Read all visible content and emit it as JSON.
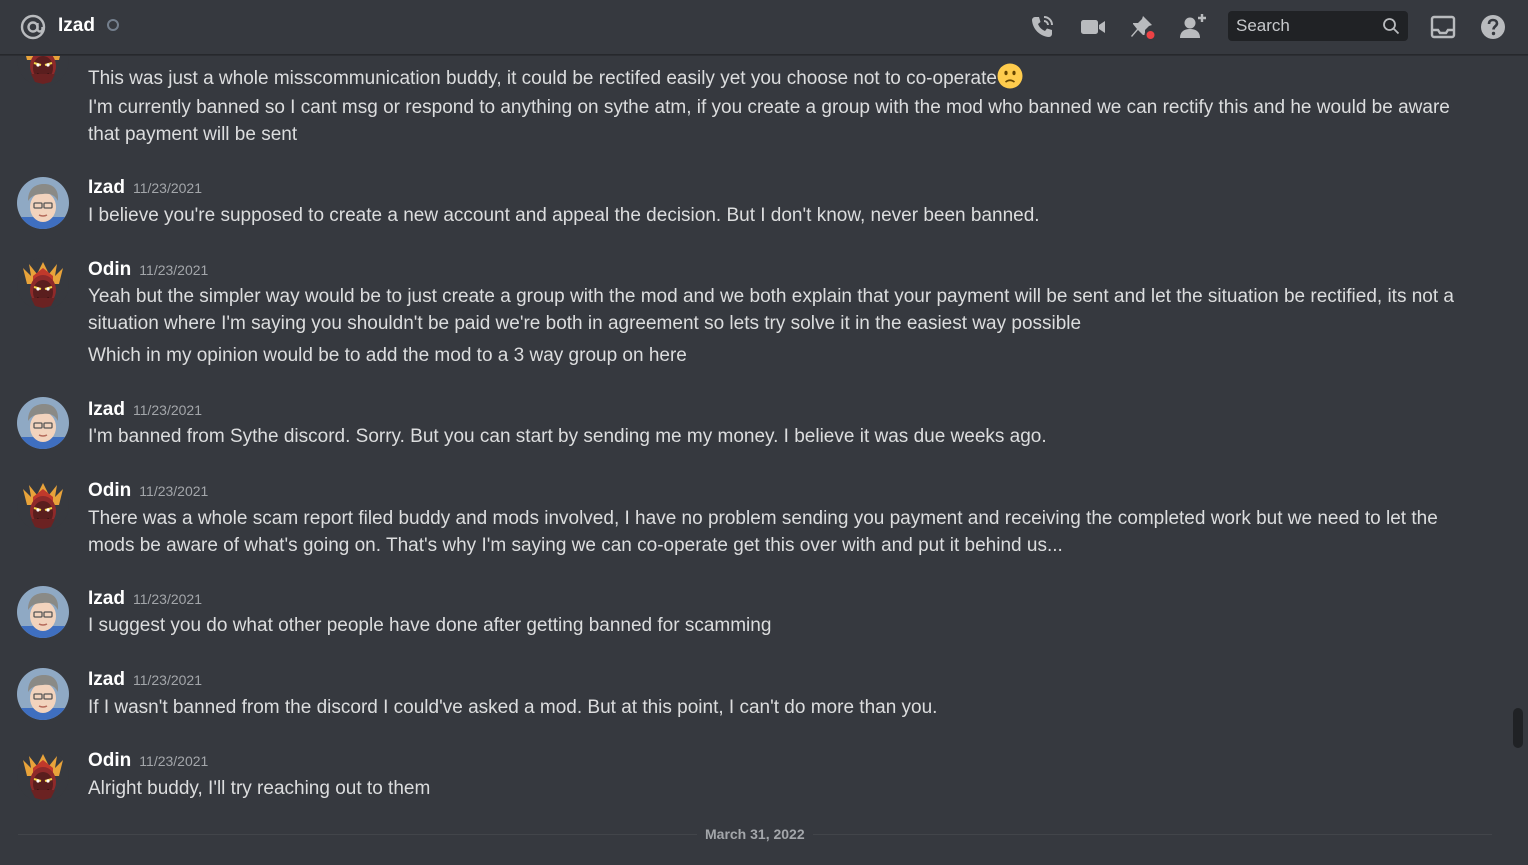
{
  "header": {
    "title": "Izad",
    "search_placeholder": "Search",
    "icons": [
      "at-icon",
      "call-icon",
      "video-icon",
      "pin-icon",
      "add-friend-icon",
      "search-icon",
      "inbox-icon",
      "help-icon"
    ]
  },
  "messages": [
    {
      "lines": [
        "This was just a whole misscommunication buddy, it could be rectifed easily yet you choose not to co-operate",
        "I'm currently banned so I cant msg or respond to anything on sythe atm, if you create a group with the mod who banned we can rectify this and he would be aware that payment will be sent"
      ],
      "emoji": "slightly-frowning-face"
    },
    {
      "author": "Izad",
      "timestamp": "11/23/2021",
      "lines": [
        "I believe you're supposed to create a new account and appeal the decision. But I don't know, never been banned."
      ]
    },
    {
      "author": "Odin",
      "timestamp": "11/23/2021",
      "lines": [
        "Yeah but the simpler way would be to just create a group with the mod and we both explain that your payment will be sent and let the situation be rectified, its not a situation where I'm saying you shouldn't be paid we're both in agreement so lets try solve it in the easiest way possible",
        "Which in my opinion would be to add the mod to a 3 way group on here"
      ]
    },
    {
      "author": "Izad",
      "timestamp": "11/23/2021",
      "lines": [
        "I'm banned from Sythe discord. Sorry. But you can start by sending me my money. I believe it was due weeks ago."
      ]
    },
    {
      "author": "Odin",
      "timestamp": "11/23/2021",
      "lines": [
        "There was a whole scam report filed buddy and mods involved, I have no problem sending you payment and receiving the completed work but we need to let the mods be aware of what's going on. That's why I'm saying we can co-operate get this over with and put it behind us..."
      ]
    },
    {
      "author": "Izad",
      "timestamp": "11/23/2021",
      "lines": [
        "I suggest you do what other people have done after getting banned for scamming"
      ]
    },
    {
      "author": "Izad",
      "timestamp": "11/23/2021",
      "lines": [
        "If I wasn't banned from the discord I could've asked a mod. But at this point, I can't do more than you."
      ]
    },
    {
      "author": "Odin",
      "timestamp": "11/23/2021",
      "lines": [
        "Alright buddy, I'll try reaching out to them"
      ]
    }
  ],
  "date_divider": "March 31, 2022",
  "colors": {
    "background": "#36393f",
    "header_bg": "#36393f",
    "text": "#dcddde",
    "username": "#ffffff",
    "timestamp": "#a3a6aa",
    "notification_dot": "#ed4245"
  }
}
